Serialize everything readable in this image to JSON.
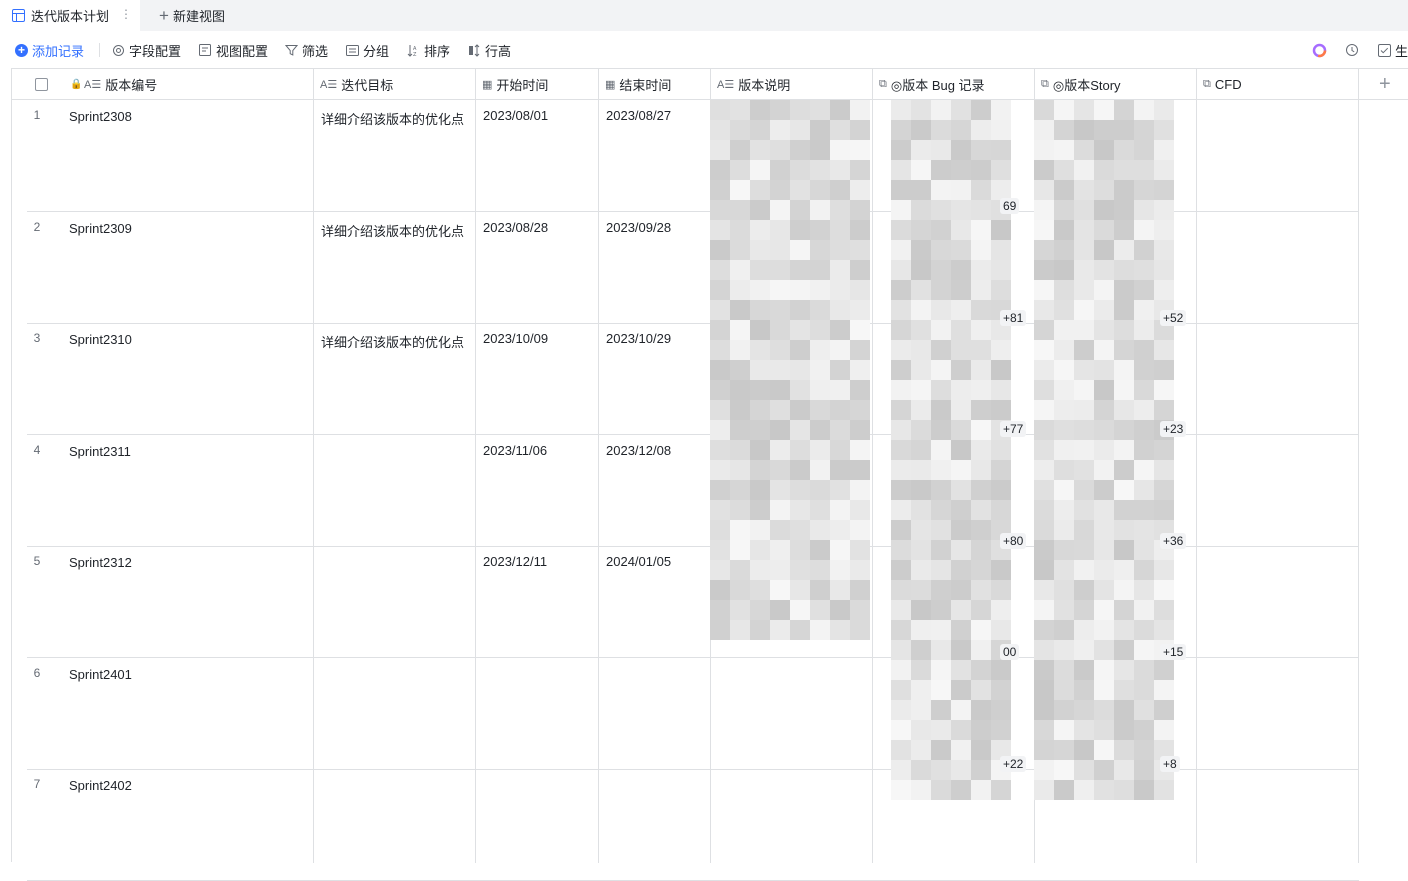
{
  "tabs": {
    "active": "迭代版本计划",
    "new_view": "新建视图"
  },
  "toolbar": {
    "add": "添加记录",
    "field_config": "字段配置",
    "view_config": "视图配置",
    "filter": "筛选",
    "group": "分组",
    "sort": "排序",
    "row_height": "行高",
    "right_item": "生"
  },
  "columns": [
    {
      "label": "版本编号",
      "icon": "text-icon"
    },
    {
      "label": "迭代目标",
      "icon": "text-icon"
    },
    {
      "label": "开始时间",
      "icon": "calendar-icon"
    },
    {
      "label": "结束时间",
      "icon": "calendar-icon"
    },
    {
      "label": "版本说明",
      "icon": "text-icon"
    },
    {
      "label": "◎版本 Bug 记录",
      "icon": "link-icon"
    },
    {
      "label": "◎版本Story",
      "icon": "link-icon"
    },
    {
      "label": "CFD",
      "icon": "link-icon"
    }
  ],
  "rows": [
    {
      "num": "1",
      "id": "Sprint2308",
      "goal": "详细介绍该版本的优化点",
      "start": "2023/08/01",
      "end": "2023/08/27",
      "bug_count": "69",
      "story_count": ""
    },
    {
      "num": "2",
      "id": "Sprint2309",
      "goal": "详细介绍该版本的优化点",
      "start": "2023/08/28",
      "end": "2023/09/28",
      "bug_count": "+81",
      "story_count": "+52"
    },
    {
      "num": "3",
      "id": "Sprint2310",
      "goal": "详细介绍该版本的优化点",
      "start": "2023/10/09",
      "end": "2023/10/29",
      "bug_count": "+77",
      "story_count": "+23"
    },
    {
      "num": "4",
      "id": "Sprint2311",
      "goal": "",
      "start": "2023/11/06",
      "end": "2023/12/08",
      "bug_count": "+80",
      "story_count": "+36"
    },
    {
      "num": "5",
      "id": "Sprint2312",
      "goal": "",
      "start": "2023/12/11",
      "end": "2024/01/05",
      "bug_count": "00",
      "story_count": "+15"
    },
    {
      "num": "6",
      "id": "Sprint2401",
      "goal": "",
      "start": "",
      "end": "",
      "bug_count": "+22",
      "story_count": "+8"
    },
    {
      "num": "7",
      "id": "Sprint2402",
      "goal": "",
      "start": "",
      "end": "",
      "bug_count": "",
      "story_count": ""
    }
  ],
  "colors": {
    "accent": "#3370ff",
    "border": "#dee0e3",
    "tabbar_bg": "#f2f3f5"
  }
}
